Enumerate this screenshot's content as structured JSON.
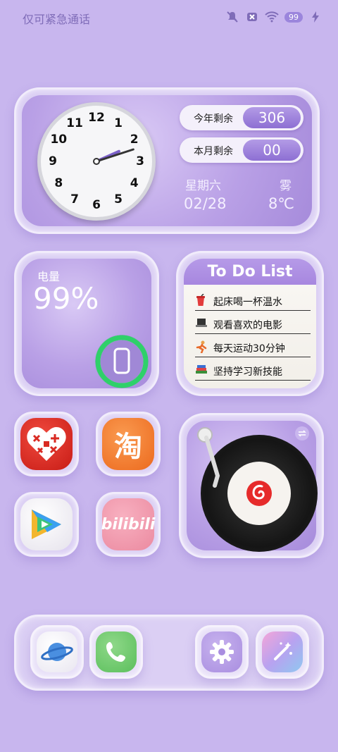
{
  "status_bar": {
    "carrier_text": "仅可紧急通话",
    "icons": [
      "mute-icon",
      "sim-off-icon",
      "wifi-icon",
      "battery-icon",
      "charging-icon"
    ],
    "battery_level": "99"
  },
  "clock_widget": {
    "clock_numbers": [
      "12",
      "1",
      "2",
      "3",
      "4",
      "5",
      "6",
      "7",
      "8",
      "9",
      "10",
      "11"
    ],
    "clock_time": {
      "hour": 2,
      "minute": 12
    },
    "year_remaining_label": "今年剩余",
    "year_remaining_value": "306",
    "month_remaining_label": "本月剩余",
    "month_remaining_value": "00",
    "weekday": "星期六",
    "date": "02/28",
    "weather": "雾",
    "temperature": "8℃"
  },
  "battery_widget": {
    "label": "电量",
    "value": "99%",
    "level": 0.99,
    "ring_color": "#2fd06a"
  },
  "todo_widget": {
    "title": "To Do List",
    "items": [
      {
        "icon": "drink-cup-icon",
        "text": "起床喝一杯温水"
      },
      {
        "icon": "laptop-icon",
        "text": "观看喜欢的电影"
      },
      {
        "icon": "runner-icon",
        "text": "每天运动30分钟"
      },
      {
        "icon": "books-icon",
        "text": "坚持学习新技能"
      }
    ]
  },
  "apps": [
    {
      "name": "pinduoduo-app",
      "icon": "heart-grid-icon",
      "color": "#d92a22"
    },
    {
      "name": "taobao-app",
      "icon": "tao-character-icon",
      "glyph": "淘",
      "color": "#f07a2c"
    },
    {
      "name": "tencent-video-app",
      "icon": "play-icon",
      "color": "#f4f4f4"
    },
    {
      "name": "bilibili-app",
      "icon": "bilibili-logo",
      "glyph": "bilibili",
      "color": "#f093a8"
    }
  ],
  "music_widget": {
    "app": "netease-music",
    "icon": "netease-music-icon"
  },
  "dock": [
    {
      "name": "browser-app",
      "icon": "planet-icon"
    },
    {
      "name": "phone-app",
      "icon": "phone-icon"
    },
    {
      "name": "settings-app",
      "icon": "gear-icon"
    },
    {
      "name": "themes-app",
      "icon": "magic-wand-icon"
    }
  ]
}
